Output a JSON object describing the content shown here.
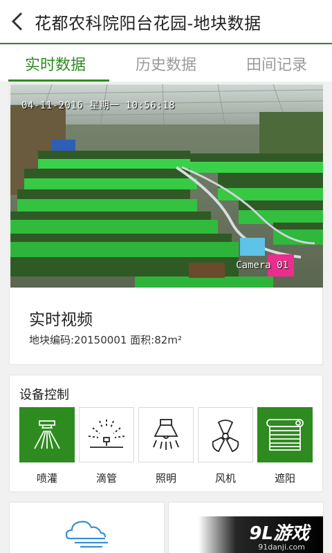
{
  "header": {
    "title": "花都农科院阳台花园-地块数据",
    "back_icon": "chevron-left-icon"
  },
  "tabs": [
    {
      "label": "实时数据",
      "active": true
    },
    {
      "label": "历史数据",
      "active": false
    },
    {
      "label": "田间记录",
      "active": false
    }
  ],
  "video": {
    "timestamp": "04-11-2016 星期一 10:56:18",
    "camera_label": "Camera 01",
    "title": "实时视频",
    "info": "地块编码:20150001 面积:82m²"
  },
  "control": {
    "title": "设备控制",
    "items": [
      {
        "label": "喷灌",
        "icon": "sprinkler-icon",
        "on": true
      },
      {
        "label": "滴管",
        "icon": "drip-irrigation-icon",
        "on": false
      },
      {
        "label": "照明",
        "icon": "lamp-icon",
        "on": false
      },
      {
        "label": "风机",
        "icon": "fan-icon",
        "on": false
      },
      {
        "label": "遮阳",
        "icon": "shade-icon",
        "on": true
      }
    ]
  },
  "weather": {
    "icon": "cloud-wind-icon"
  },
  "watermark": {
    "main": "9L游戏",
    "sub": "91danji.com"
  },
  "colors": {
    "accent": "#2e8b1f",
    "inactive_tab": "#9a9a9a"
  }
}
